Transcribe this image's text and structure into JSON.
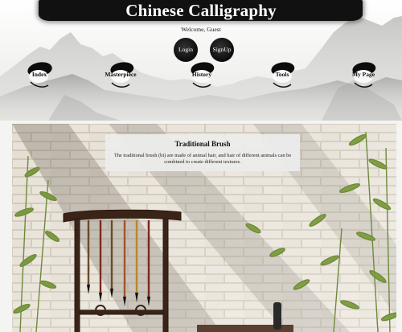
{
  "header": {
    "title": "Chinese Calligraphy",
    "welcome": "Welcome, Guest",
    "login_label": "Login",
    "signup_label": "SignUp"
  },
  "nav": [
    {
      "label": "Index"
    },
    {
      "label": "Masterpiece"
    },
    {
      "label": "History"
    },
    {
      "label": "Tools"
    },
    {
      "label": "My Page"
    }
  ],
  "feature": {
    "title": "Traditional Brush",
    "description": "The traditional brush (bi) are made of animal hair, and hair of different animals can be combined to create different textures."
  },
  "colors": {
    "ink": "#111111",
    "paper": "#f4f4f2"
  }
}
